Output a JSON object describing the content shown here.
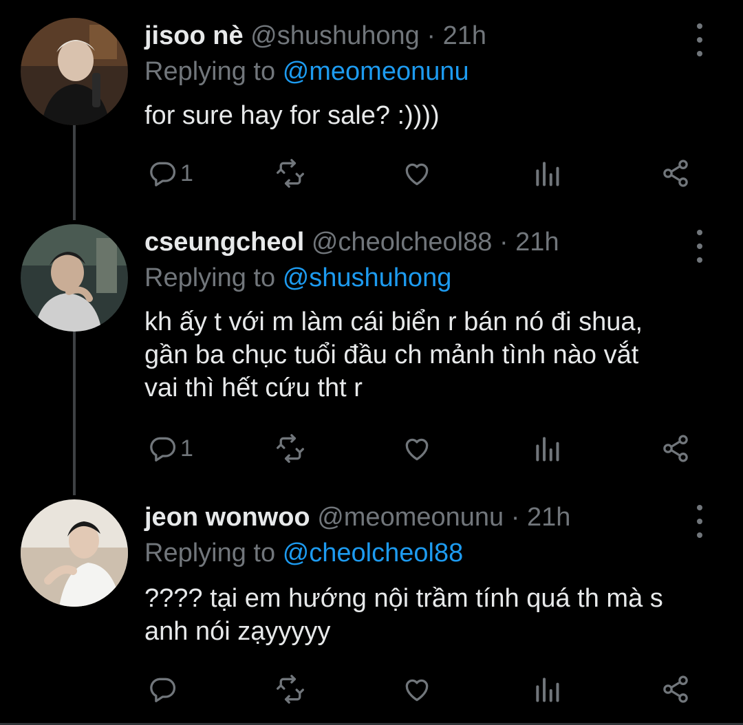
{
  "colors": {
    "background": "#000000",
    "primary_text": "#e7e9ea",
    "secondary_text": "#71767b",
    "mention": "#1d9bf0",
    "thread_line": "#3e4144"
  },
  "icons": {
    "reply": "reply-icon",
    "retweet": "retweet-icon",
    "like": "heart-icon",
    "analytics": "analytics-icon",
    "share": "share-icon",
    "more": "more-vertical-icon"
  },
  "tweets": [
    {
      "name": "jisoo nè",
      "handle": "@shushuhong",
      "separator": "·",
      "time": "21h",
      "replying_prefix": "Replying to",
      "replying_to": "@meomeonunu",
      "text": "for sure hay for sale? :))))",
      "reply_count": "1"
    },
    {
      "name": "cseungcheol",
      "handle": "@cheolcheol88",
      "separator": "·",
      "time": "21h",
      "replying_prefix": "Replying to",
      "replying_to": "@shushuhong",
      "text": "kh ấy t với m làm cái biển r bán nó đi shua,\ngần ba chục tuổi đầu ch mảnh tình nào vắt\nvai thì hết cứu tht r",
      "reply_count": "1"
    },
    {
      "name": "jeon wonwoo",
      "handle": "@meomeonunu",
      "separator": "·",
      "time": "21h",
      "replying_prefix": "Replying to",
      "replying_to": "@cheolcheol88",
      "text": "???? tại em hướng nội trầm tính quá th mà s\nanh nói zạyyyyy",
      "reply_count": ""
    }
  ]
}
